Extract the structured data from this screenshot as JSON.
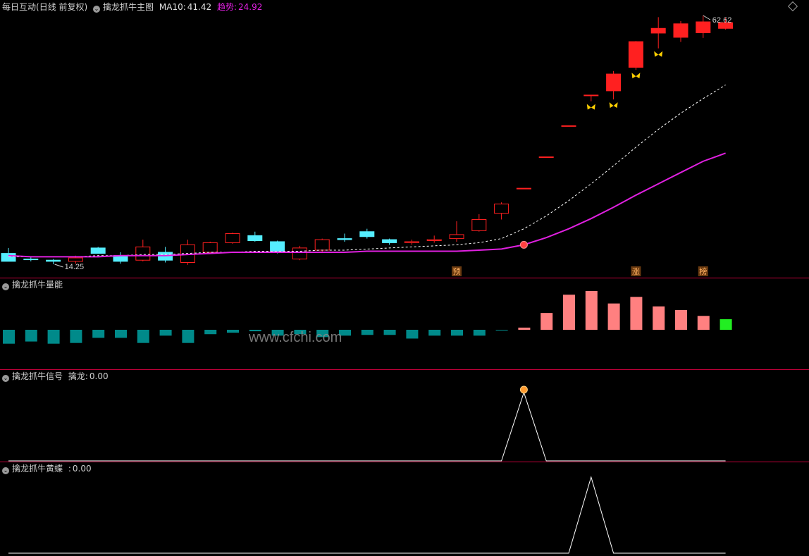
{
  "panel1": {
    "stock_name": "每日互动",
    "period": "(日线 前复权)",
    "indicator": "擒龙抓牛主图",
    "ma10_label": "MA10:",
    "ma10_value": "41.42",
    "trend_label": "趋势:",
    "trend_value": "24.92",
    "high_label": "62.62",
    "low_label": "14.25",
    "markers": [
      "预",
      "涨",
      "榜"
    ]
  },
  "panel2": {
    "indicator": "擒龙抓牛量能"
  },
  "panel3": {
    "indicator": "擒龙抓牛信号",
    "value_label": "擒龙:",
    "value": "0.00"
  },
  "panel4": {
    "indicator": "擒龙抓牛黄蝶",
    "value_label": ":",
    "value": "0.00"
  },
  "watermark": "www.cfchi.com",
  "colors": {
    "up": "#ff2020",
    "down": "#55eeff",
    "vol_up": "#ff8080",
    "vol_down": "#008a8a",
    "trend": "#e020e0",
    "last_vol": "#22ee22"
  },
  "chart_data": [
    {
      "type": "candlestick",
      "title": "擒龙抓牛主图",
      "candles": [
        {
          "o": 15.2,
          "h": 15.7,
          "l": 14.5,
          "c": 14.5,
          "up": false
        },
        {
          "o": 14.7,
          "h": 14.9,
          "l": 14.5,
          "c": 14.7,
          "up": false
        },
        {
          "o": 14.6,
          "h": 14.7,
          "l": 14.25,
          "c": 14.5,
          "up": false
        },
        {
          "o": 14.5,
          "h": 15.0,
          "l": 14.3,
          "c": 14.8,
          "up": true
        },
        {
          "o": 15.7,
          "h": 15.8,
          "l": 15.2,
          "c": 15.2,
          "up": false
        },
        {
          "o": 15.0,
          "h": 15.3,
          "l": 14.3,
          "c": 14.5,
          "up": false
        },
        {
          "o": 14.6,
          "h": 16.5,
          "l": 14.5,
          "c": 15.8,
          "up": true
        },
        {
          "o": 15.3,
          "h": 15.8,
          "l": 14.4,
          "c": 14.6,
          "up": false
        },
        {
          "o": 14.4,
          "h": 16.5,
          "l": 14.2,
          "c": 16.0,
          "up": true
        },
        {
          "o": 15.3,
          "h": 16.3,
          "l": 15.2,
          "c": 16.2,
          "up": true
        },
        {
          "o": 16.2,
          "h": 17.2,
          "l": 16.1,
          "c": 17.1,
          "up": true
        },
        {
          "o": 16.9,
          "h": 17.3,
          "l": 16.3,
          "c": 16.4,
          "up": false
        },
        {
          "o": 16.3,
          "h": 16.4,
          "l": 15.2,
          "c": 15.4,
          "up": false
        },
        {
          "o": 14.7,
          "h": 15.9,
          "l": 14.6,
          "c": 15.7,
          "up": true
        },
        {
          "o": 15.5,
          "h": 16.6,
          "l": 15.3,
          "c": 16.5,
          "up": true
        },
        {
          "o": 16.5,
          "h": 17.1,
          "l": 16.3,
          "c": 16.6,
          "up": false
        },
        {
          "o": 17.3,
          "h": 17.6,
          "l": 16.6,
          "c": 16.8,
          "up": false
        },
        {
          "o": 16.5,
          "h": 16.6,
          "l": 16.0,
          "c": 16.2,
          "up": false
        },
        {
          "o": 16.3,
          "h": 16.5,
          "l": 16.0,
          "c": 16.2,
          "up": true
        },
        {
          "o": 16.4,
          "h": 16.9,
          "l": 16.2,
          "c": 16.5,
          "up": true
        },
        {
          "o": 16.6,
          "h": 18.4,
          "l": 16.3,
          "c": 17.0,
          "up": true
        },
        {
          "o": 17.4,
          "h": 19.2,
          "l": 17.3,
          "c": 18.6,
          "up": true
        },
        {
          "o": 19.3,
          "h": 20.6,
          "l": 18.6,
          "c": 20.4,
          "up": true
        },
        {
          "o": 22.4,
          "h": 22.4,
          "l": 22.4,
          "c": 22.4,
          "up": true
        },
        {
          "o": 27.0,
          "h": 27.0,
          "l": 27.0,
          "c": 27.0,
          "up": true
        },
        {
          "o": 32.5,
          "h": 32.5,
          "l": 32.5,
          "c": 32.5,
          "up": true
        },
        {
          "o": 39.0,
          "h": 39.0,
          "l": 37.6,
          "c": 39.0,
          "up": true
        },
        {
          "o": 40.0,
          "h": 45.0,
          "l": 38.0,
          "c": 44.2,
          "up": true
        },
        {
          "o": 46.0,
          "h": 53.8,
          "l": 45.3,
          "c": 53.6,
          "up": true
        },
        {
          "o": 56.4,
          "h": 62.0,
          "l": 51.5,
          "c": 58.0,
          "up": true
        },
        {
          "o": 55.0,
          "h": 60.6,
          "l": 53.5,
          "c": 59.6,
          "up": true
        },
        {
          "o": 56.5,
          "h": 62.62,
          "l": 54.8,
          "c": 60.3,
          "up": true
        },
        {
          "o": 58.0,
          "h": 61.8,
          "l": 57.6,
          "c": 60.0,
          "up": true
        }
      ],
      "trend": [
        15.0,
        14.9,
        14.9,
        14.9,
        14.9,
        15.0,
        15.0,
        15.0,
        15.1,
        15.2,
        15.3,
        15.3,
        15.3,
        15.3,
        15.3,
        15.3,
        15.4,
        15.4,
        15.4,
        15.4,
        15.4,
        15.5,
        15.6,
        16.0,
        16.7,
        17.6,
        18.7,
        20.0,
        21.5,
        23.0,
        24.6,
        26.3,
        27.6
      ],
      "ma10": [
        14.9,
        14.9,
        14.9,
        14.9,
        15.0,
        15.0,
        15.1,
        15.1,
        15.2,
        15.3,
        15.3,
        15.4,
        15.4,
        15.4,
        15.5,
        15.5,
        15.6,
        15.7,
        15.8,
        15.9,
        16.0,
        16.2,
        16.6,
        17.6,
        19.0,
        20.8,
        23.0,
        25.6,
        28.6,
        31.8,
        35.0,
        38.2,
        41.42
      ],
      "y_range": [
        14.25,
        62.62
      ]
    },
    {
      "type": "bar",
      "title": "擒龙抓牛量能",
      "values": [
        -1.9,
        -1.6,
        -1.9,
        -1.8,
        -1.1,
        -1.1,
        -1.8,
        -0.8,
        -1.8,
        -0.6,
        -0.4,
        -0.2,
        -0.8,
        -0.6,
        -1.0,
        -0.8,
        -0.7,
        -0.7,
        -1.2,
        -0.8,
        -0.8,
        -0.8,
        -0.1,
        0.3,
        2.3,
        4.8,
        5.3,
        3.6,
        4.5,
        3.2,
        2.7,
        1.9,
        1.5
      ]
    },
    {
      "type": "line",
      "title": "擒龙抓牛信号",
      "values": [
        0,
        0,
        0,
        0,
        0,
        0,
        0,
        0,
        0,
        0,
        0,
        0,
        0,
        0,
        0,
        0,
        0,
        0,
        0,
        0,
        0,
        0,
        0,
        1,
        0,
        0,
        0,
        0,
        0,
        0,
        0,
        0,
        0
      ]
    },
    {
      "type": "line",
      "title": "擒龙抓牛黄蝶",
      "values": [
        0,
        0,
        0,
        0,
        0,
        0,
        0,
        0,
        0,
        0,
        0,
        0,
        0,
        0,
        0,
        0,
        0,
        0,
        0,
        0,
        0,
        0,
        0,
        0,
        0,
        0,
        1,
        0,
        0,
        0,
        0,
        0,
        0
      ]
    }
  ]
}
